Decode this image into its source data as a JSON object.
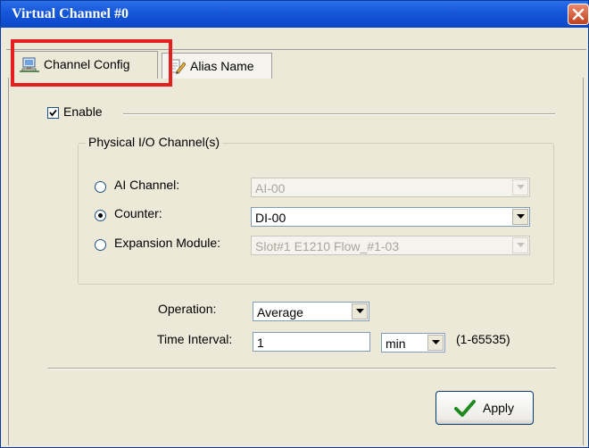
{
  "window": {
    "title": "Virtual Channel #0"
  },
  "tabs": [
    {
      "label": "Channel Config",
      "icon": "network-computer-icon",
      "active": true
    },
    {
      "label": "Alias Name",
      "icon": "edit-document-icon",
      "active": false
    }
  ],
  "enable": {
    "label": "Enable",
    "checked": true
  },
  "physical_group": {
    "legend": "Physical I/O Channel(s)",
    "options": [
      {
        "label": "AI Channel:",
        "selected": false,
        "value": "AI-00",
        "enabled": false
      },
      {
        "label": "Counter:",
        "selected": true,
        "value": "DI-00",
        "enabled": true
      },
      {
        "label": "Expansion Module:",
        "selected": false,
        "value": "Slot#1 E1210 Flow_#1-03",
        "enabled": false
      }
    ]
  },
  "operation": {
    "label": "Operation:",
    "value": "Average"
  },
  "time_interval": {
    "label": "Time Interval:",
    "value": "1",
    "unit": "min",
    "range": "(1-65535)"
  },
  "apply_button": {
    "label": "Apply"
  },
  "colors": {
    "titlebar": "#1556d8",
    "highlight": "#e51f1f",
    "dialog_bg": "#ece9d8",
    "check_green": "#1e8a1e"
  }
}
